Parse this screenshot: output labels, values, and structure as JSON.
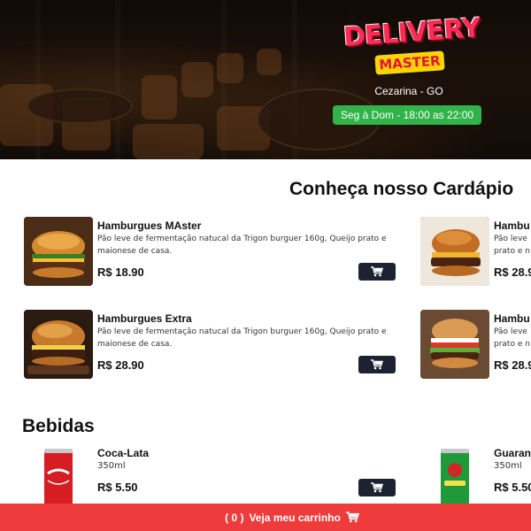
{
  "header": {
    "logo_word1": "DELIVERY",
    "logo_word2": "MASTER",
    "city": "Cezarina - GO",
    "hours": "Seg à Dom - 18:00 as 22:00"
  },
  "menu": {
    "title": "Conheça nosso Cardápio",
    "items": [
      {
        "name": "Hamburgues MAster",
        "description": "Pão leve de fermentação natucal da Trigon burguer 160g, Queijo prato e maionese de casa.",
        "price": "R$ 18.90"
      },
      {
        "name": "Hambu",
        "description": "Pão leve\nprato e n",
        "price": "R$ 28.9"
      },
      {
        "name": "Hamburgues Extra",
        "description": "Pão leve de fermentação natucal da Trigon burguer 160g, Queijo prato e maionese de casa.",
        "price": "R$ 28.90"
      },
      {
        "name": "Hambu",
        "description": "Pão leve\nprato e n",
        "price": "R$ 28.9"
      }
    ]
  },
  "drinks": {
    "title": "Bebidas",
    "items": [
      {
        "name": "Coca-Lata",
        "size": "350ml",
        "price": "R$ 5.50"
      },
      {
        "name": "Guaran",
        "size": "350ml",
        "price": "R$ 5.50"
      }
    ]
  },
  "cart_bar": {
    "count": "( 0 )",
    "label": "Veja meu carrinho"
  },
  "icons": {
    "cart": "cart-icon"
  },
  "colors": {
    "hours_badge": "#32b34a",
    "cart_button": "#1d2233",
    "cart_bar": "#ef3b3b",
    "logo_red": "#ff2d55",
    "logo_yellow": "#ffd400"
  }
}
